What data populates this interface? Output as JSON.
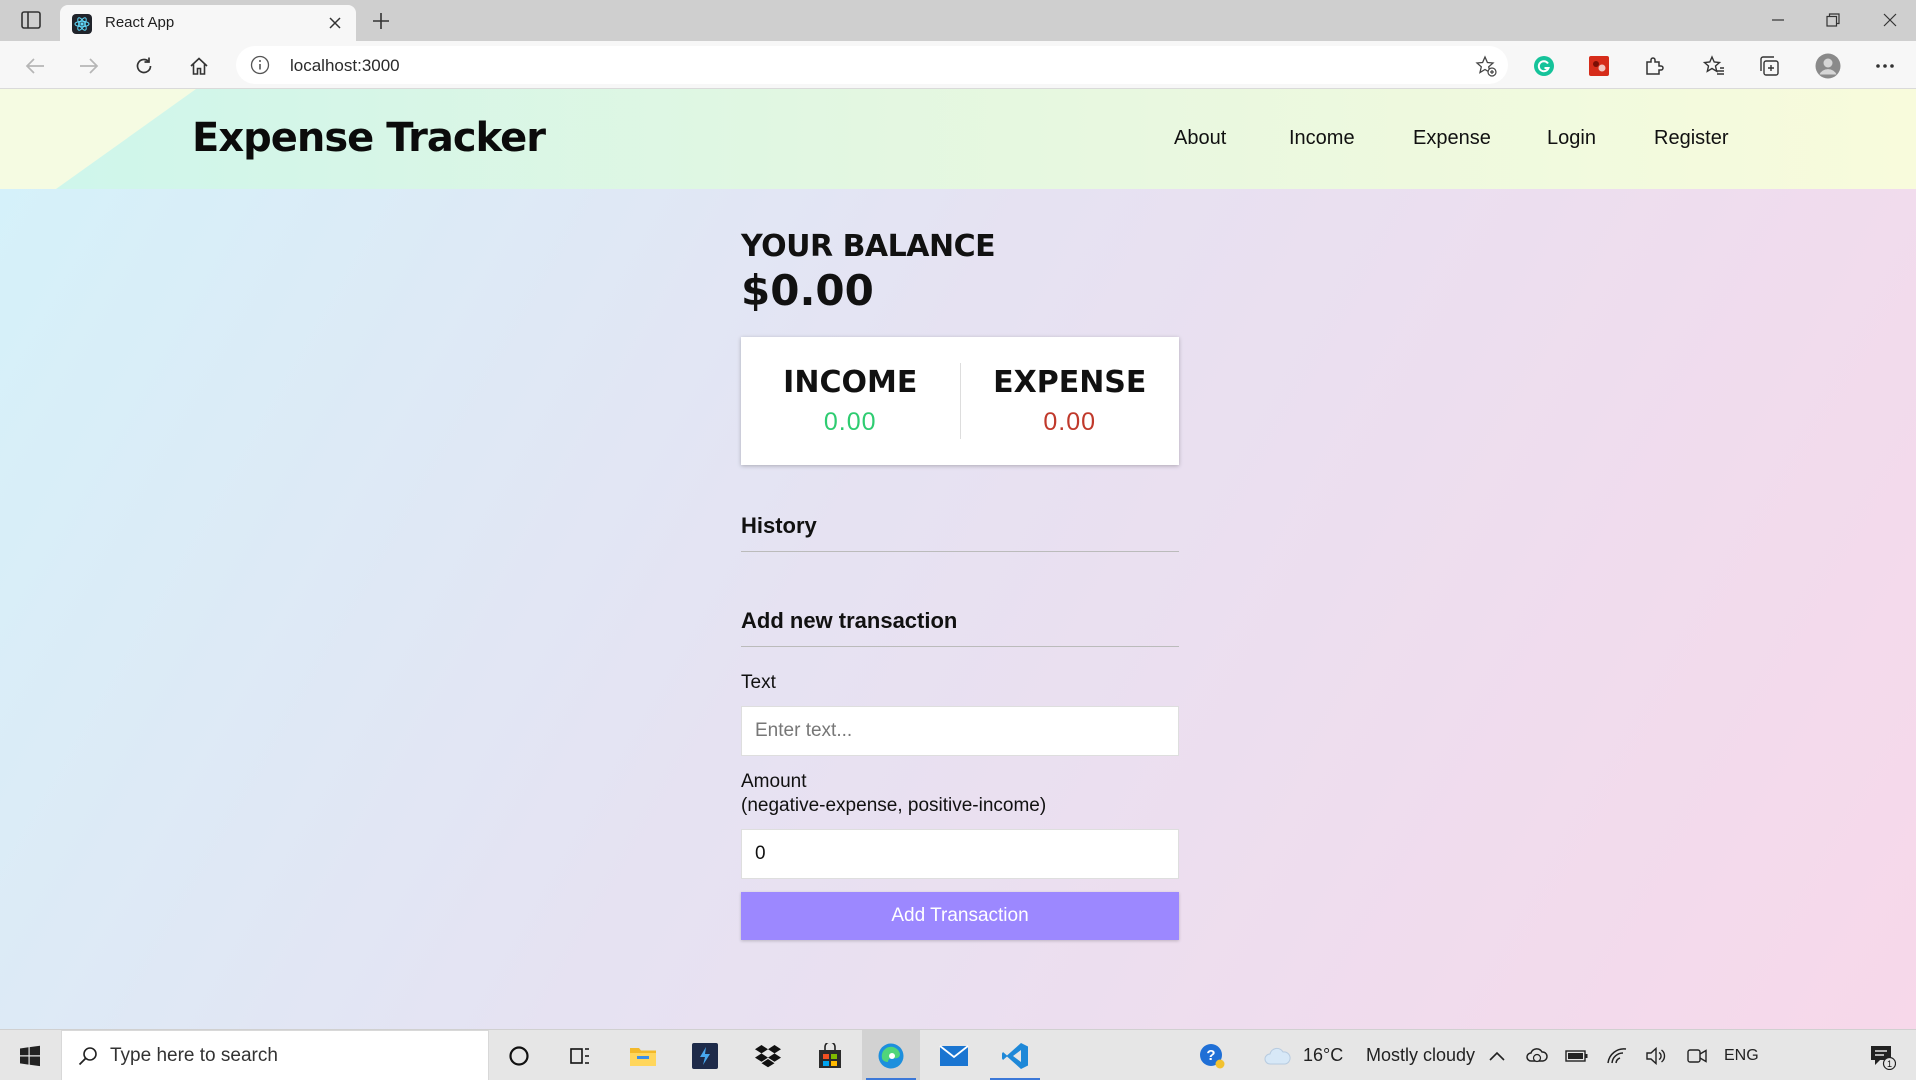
{
  "browser": {
    "tab_title": "React App",
    "url": "localhost:3000"
  },
  "header": {
    "brand": "Expense Tracker",
    "nav": [
      "About",
      "Income",
      "Expense",
      "Login",
      "Register"
    ]
  },
  "balance": {
    "label": "YOUR BALANCE",
    "value": "$0.00"
  },
  "summary": {
    "income_label": "INCOME",
    "income_value": "0.00",
    "expense_label": "EXPENSE",
    "expense_value": "0.00",
    "income_color": "#2ecc71",
    "expense_color": "#c0392b"
  },
  "history": {
    "title": "History"
  },
  "form": {
    "title": "Add new transaction",
    "text_label": "Text",
    "text_placeholder": "Enter text...",
    "amount_label": "Amount",
    "amount_hint": "(negative-expense, positive-income)",
    "amount_value": "0",
    "submit_label": "Add Transaction",
    "submit_color": "#9c88ff"
  },
  "taskbar": {
    "search_placeholder": "Type here to search",
    "temperature": "16°C",
    "weather": "Mostly cloudy",
    "language": "ENG",
    "notification_count": "1"
  }
}
